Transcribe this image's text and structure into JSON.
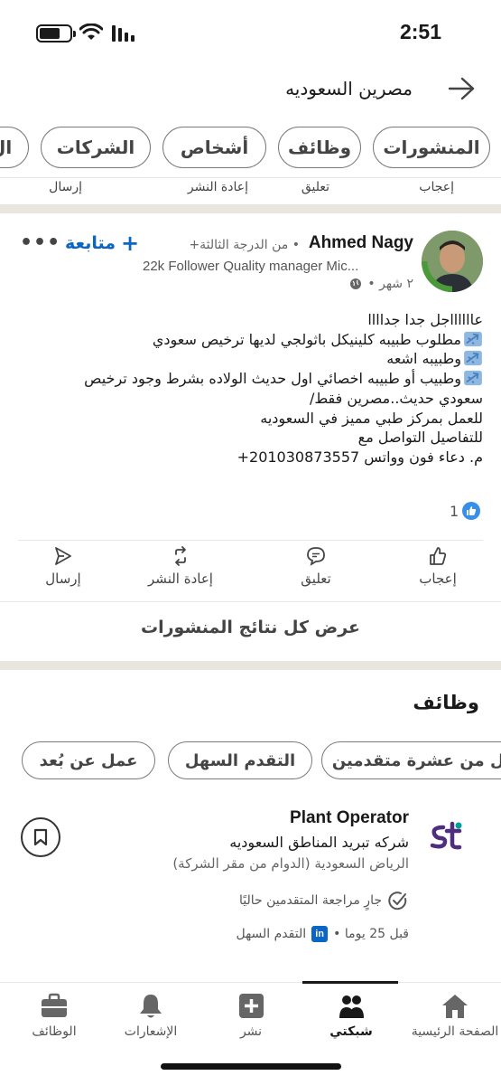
{
  "status_bar": {
    "time": "2:51"
  },
  "header": {
    "search_query": "مصرين السعوديه"
  },
  "filter_chips": [
    "المنشورات",
    "وظائف",
    "أشخاص",
    "الشركات",
    "ال"
  ],
  "top_action_labels": {
    "like": "إعجاب",
    "comment": "تعليق",
    "repost": "إعادة النشر",
    "send": "إرسال"
  },
  "post": {
    "author_name": "Ahmed Nagy",
    "degree": "• من الدرجة الثالثة+",
    "follow_label": "متابعة",
    "headline": "22k Follower Quality manager Mic...",
    "time_ago": "٢ شهر •",
    "avatar_badge": "#OPENTOWORK",
    "body": {
      "l1": "عااااااجل جدا جداااا",
      "l2": "مطلوب طبيبه كلينيكل باثولجي لديها ترخيص سعودي",
      "l3": "وطبيبه اشعه",
      "l4": "وطبيب أو طبيبه اخصائي اول حديث الولاده بشرط وجود ترخيص",
      "l5": "سعودي حديث..مصرين فقط/",
      "l6": "للعمل بمركز طبي مميز في السعوديه",
      "l7": "للتفاصيل التواصل مع",
      "l8": "م. دعاء فون وواتس 201030873557+"
    },
    "reaction_count": "1",
    "actions": {
      "like": "إعجاب",
      "comment": "تعليق",
      "repost": "إعادة النشر",
      "send": "إرسال"
    }
  },
  "see_all_label": "عرض كل نتائج المنشورات",
  "jobs": {
    "title": "وظائف",
    "chips": [
      "عمل عن بُعد",
      "التقدم السهل",
      "أقل من عشرة متقدمين"
    ],
    "item": {
      "title": "Plant Operator",
      "company": "شركه تبريد المناطق السعوديه",
      "location": "الرياض السعودية (الدوام من مقر الشركة)",
      "status": "جارٍ مراجعة المتقدمين حاليًا",
      "posted": "قبل 25 يوما •",
      "easy_apply": "التقدم السهل",
      "logo_text": "st"
    }
  },
  "bottom_nav": {
    "home": "الصفحة الرئيسية",
    "network": "شبكتي",
    "post": "نشر",
    "notifications": "الإشعارات",
    "jobs": "الوظائف"
  },
  "colors": {
    "accent": "#0a66c2",
    "logo_purple": "#4f2d7f",
    "logo_teal": "#00a19a"
  }
}
